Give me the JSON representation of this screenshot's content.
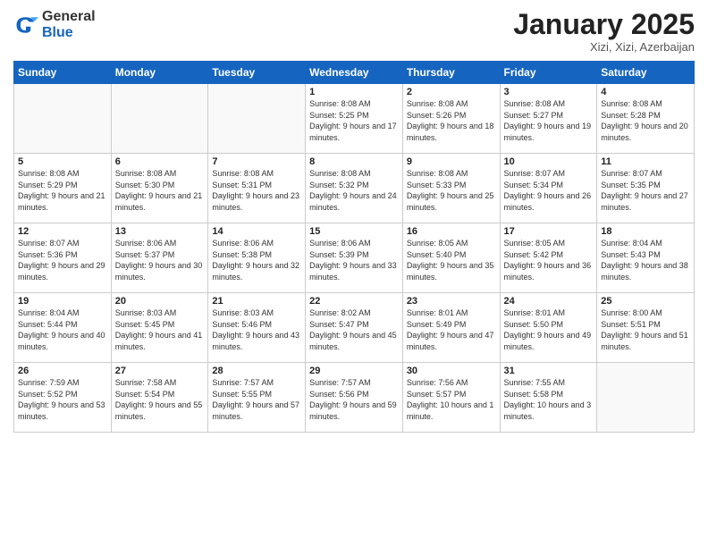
{
  "logo": {
    "general": "General",
    "blue": "Blue"
  },
  "header": {
    "month": "January 2025",
    "location": "Xizi, Xizi, Azerbaijan"
  },
  "weekdays": [
    "Sunday",
    "Monday",
    "Tuesday",
    "Wednesday",
    "Thursday",
    "Friday",
    "Saturday"
  ],
  "weeks": [
    [
      {
        "day": "",
        "sunrise": "",
        "sunset": "",
        "daylight": ""
      },
      {
        "day": "",
        "sunrise": "",
        "sunset": "",
        "daylight": ""
      },
      {
        "day": "",
        "sunrise": "",
        "sunset": "",
        "daylight": ""
      },
      {
        "day": "1",
        "sunrise": "Sunrise: 8:08 AM",
        "sunset": "Sunset: 5:25 PM",
        "daylight": "Daylight: 9 hours and 17 minutes."
      },
      {
        "day": "2",
        "sunrise": "Sunrise: 8:08 AM",
        "sunset": "Sunset: 5:26 PM",
        "daylight": "Daylight: 9 hours and 18 minutes."
      },
      {
        "day": "3",
        "sunrise": "Sunrise: 8:08 AM",
        "sunset": "Sunset: 5:27 PM",
        "daylight": "Daylight: 9 hours and 19 minutes."
      },
      {
        "day": "4",
        "sunrise": "Sunrise: 8:08 AM",
        "sunset": "Sunset: 5:28 PM",
        "daylight": "Daylight: 9 hours and 20 minutes."
      }
    ],
    [
      {
        "day": "5",
        "sunrise": "Sunrise: 8:08 AM",
        "sunset": "Sunset: 5:29 PM",
        "daylight": "Daylight: 9 hours and 21 minutes."
      },
      {
        "day": "6",
        "sunrise": "Sunrise: 8:08 AM",
        "sunset": "Sunset: 5:30 PM",
        "daylight": "Daylight: 9 hours and 21 minutes."
      },
      {
        "day": "7",
        "sunrise": "Sunrise: 8:08 AM",
        "sunset": "Sunset: 5:31 PM",
        "daylight": "Daylight: 9 hours and 23 minutes."
      },
      {
        "day": "8",
        "sunrise": "Sunrise: 8:08 AM",
        "sunset": "Sunset: 5:32 PM",
        "daylight": "Daylight: 9 hours and 24 minutes."
      },
      {
        "day": "9",
        "sunrise": "Sunrise: 8:08 AM",
        "sunset": "Sunset: 5:33 PM",
        "daylight": "Daylight: 9 hours and 25 minutes."
      },
      {
        "day": "10",
        "sunrise": "Sunrise: 8:07 AM",
        "sunset": "Sunset: 5:34 PM",
        "daylight": "Daylight: 9 hours and 26 minutes."
      },
      {
        "day": "11",
        "sunrise": "Sunrise: 8:07 AM",
        "sunset": "Sunset: 5:35 PM",
        "daylight": "Daylight: 9 hours and 27 minutes."
      }
    ],
    [
      {
        "day": "12",
        "sunrise": "Sunrise: 8:07 AM",
        "sunset": "Sunset: 5:36 PM",
        "daylight": "Daylight: 9 hours and 29 minutes."
      },
      {
        "day": "13",
        "sunrise": "Sunrise: 8:06 AM",
        "sunset": "Sunset: 5:37 PM",
        "daylight": "Daylight: 9 hours and 30 minutes."
      },
      {
        "day": "14",
        "sunrise": "Sunrise: 8:06 AM",
        "sunset": "Sunset: 5:38 PM",
        "daylight": "Daylight: 9 hours and 32 minutes."
      },
      {
        "day": "15",
        "sunrise": "Sunrise: 8:06 AM",
        "sunset": "Sunset: 5:39 PM",
        "daylight": "Daylight: 9 hours and 33 minutes."
      },
      {
        "day": "16",
        "sunrise": "Sunrise: 8:05 AM",
        "sunset": "Sunset: 5:40 PM",
        "daylight": "Daylight: 9 hours and 35 minutes."
      },
      {
        "day": "17",
        "sunrise": "Sunrise: 8:05 AM",
        "sunset": "Sunset: 5:42 PM",
        "daylight": "Daylight: 9 hours and 36 minutes."
      },
      {
        "day": "18",
        "sunrise": "Sunrise: 8:04 AM",
        "sunset": "Sunset: 5:43 PM",
        "daylight": "Daylight: 9 hours and 38 minutes."
      }
    ],
    [
      {
        "day": "19",
        "sunrise": "Sunrise: 8:04 AM",
        "sunset": "Sunset: 5:44 PM",
        "daylight": "Daylight: 9 hours and 40 minutes."
      },
      {
        "day": "20",
        "sunrise": "Sunrise: 8:03 AM",
        "sunset": "Sunset: 5:45 PM",
        "daylight": "Daylight: 9 hours and 41 minutes."
      },
      {
        "day": "21",
        "sunrise": "Sunrise: 8:03 AM",
        "sunset": "Sunset: 5:46 PM",
        "daylight": "Daylight: 9 hours and 43 minutes."
      },
      {
        "day": "22",
        "sunrise": "Sunrise: 8:02 AM",
        "sunset": "Sunset: 5:47 PM",
        "daylight": "Daylight: 9 hours and 45 minutes."
      },
      {
        "day": "23",
        "sunrise": "Sunrise: 8:01 AM",
        "sunset": "Sunset: 5:49 PM",
        "daylight": "Daylight: 9 hours and 47 minutes."
      },
      {
        "day": "24",
        "sunrise": "Sunrise: 8:01 AM",
        "sunset": "Sunset: 5:50 PM",
        "daylight": "Daylight: 9 hours and 49 minutes."
      },
      {
        "day": "25",
        "sunrise": "Sunrise: 8:00 AM",
        "sunset": "Sunset: 5:51 PM",
        "daylight": "Daylight: 9 hours and 51 minutes."
      }
    ],
    [
      {
        "day": "26",
        "sunrise": "Sunrise: 7:59 AM",
        "sunset": "Sunset: 5:52 PM",
        "daylight": "Daylight: 9 hours and 53 minutes."
      },
      {
        "day": "27",
        "sunrise": "Sunrise: 7:58 AM",
        "sunset": "Sunset: 5:54 PM",
        "daylight": "Daylight: 9 hours and 55 minutes."
      },
      {
        "day": "28",
        "sunrise": "Sunrise: 7:57 AM",
        "sunset": "Sunset: 5:55 PM",
        "daylight": "Daylight: 9 hours and 57 minutes."
      },
      {
        "day": "29",
        "sunrise": "Sunrise: 7:57 AM",
        "sunset": "Sunset: 5:56 PM",
        "daylight": "Daylight: 9 hours and 59 minutes."
      },
      {
        "day": "30",
        "sunrise": "Sunrise: 7:56 AM",
        "sunset": "Sunset: 5:57 PM",
        "daylight": "Daylight: 10 hours and 1 minute."
      },
      {
        "day": "31",
        "sunrise": "Sunrise: 7:55 AM",
        "sunset": "Sunset: 5:58 PM",
        "daylight": "Daylight: 10 hours and 3 minutes."
      },
      {
        "day": "",
        "sunrise": "",
        "sunset": "",
        "daylight": ""
      }
    ]
  ]
}
